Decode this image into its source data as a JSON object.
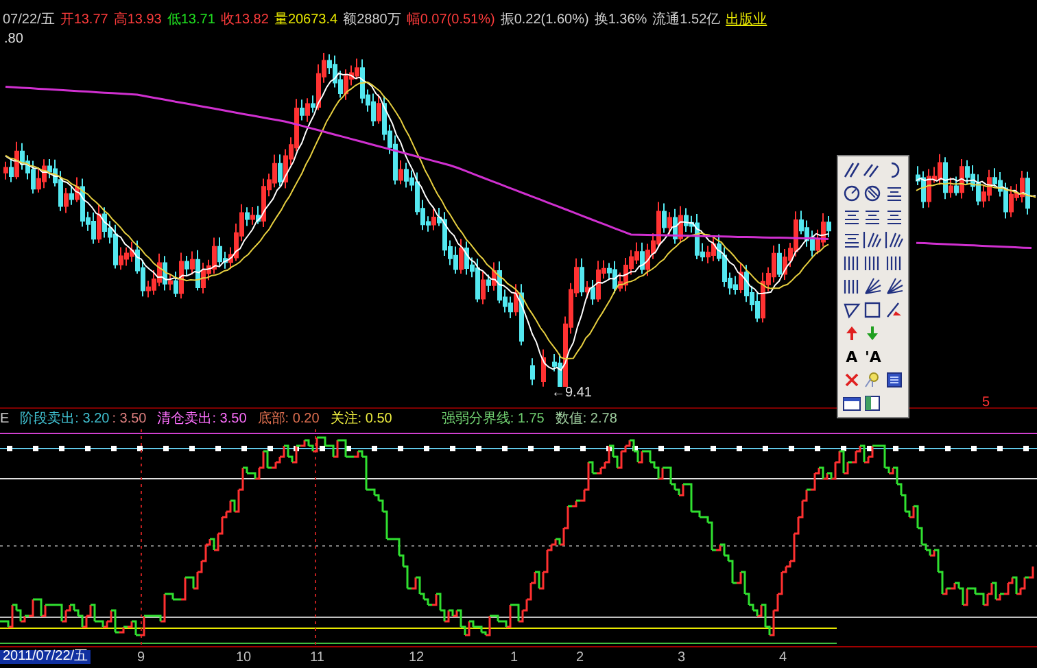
{
  "quote_bar": {
    "date": "07/22/五",
    "fields": [
      {
        "label": "开",
        "value": "13.77",
        "color": "#ff3c3c"
      },
      {
        "label": "高",
        "value": "13.93",
        "color": "#ff3c3c"
      },
      {
        "label": "低",
        "value": "13.71",
        "color": "#20e020"
      },
      {
        "label": "收",
        "value": "13.82",
        "color": "#ff3c3c"
      },
      {
        "label": "量",
        "value": "20673.4",
        "color": "#e8e800"
      },
      {
        "label": "额",
        "value": "2880万",
        "color": "#d0d0d0"
      },
      {
        "label": "幅",
        "value": "0.07(0.51%)",
        "color": "#ff3c3c"
      },
      {
        "label": "振",
        "value": "0.22(1.60%)",
        "color": "#d0d0d0"
      },
      {
        "label": "换",
        "value": "1.36%",
        "color": "#d0d0d0"
      },
      {
        "label": "流通",
        "value": "1.52亿",
        "color": "#d0d0d0"
      }
    ],
    "industry": "出版业"
  },
  "price_chart": {
    "axis_label": ".80",
    "low_marker": "←9.41",
    "marker": "5"
  },
  "toolbox": {
    "tools": [
      {
        "kind": "line"
      },
      {
        "kind": "parallel"
      },
      {
        "kind": "arc"
      },
      {
        "kind": "circle"
      },
      {
        "kind": "hatched-circle"
      },
      {
        "kind": "text-lines"
      },
      {
        "kind": "text-lines"
      },
      {
        "kind": "text-lines"
      },
      {
        "kind": "text-lines"
      },
      {
        "kind": "text-lines"
      },
      {
        "kind": "fan"
      },
      {
        "kind": "fan"
      },
      {
        "kind": "bars"
      },
      {
        "kind": "bars"
      },
      {
        "kind": "bars"
      },
      {
        "kind": "bars"
      },
      {
        "kind": "rays"
      },
      {
        "kind": "rays"
      },
      {
        "kind": "triangle"
      },
      {
        "kind": "rectangle"
      },
      {
        "kind": "pen"
      },
      {
        "kind": "up-arrow"
      },
      {
        "kind": "down-arrow"
      },
      {
        "kind": "letter",
        "label": "A"
      },
      {
        "kind": "letter",
        "label": "'A"
      },
      {
        "kind": "cross"
      },
      {
        "kind": "bulb"
      },
      {
        "kind": "panel"
      },
      {
        "kind": "window"
      },
      {
        "kind": "sidebar-window"
      }
    ]
  },
  "indicator": {
    "cut_label": "E",
    "readings": [
      {
        "text": "阶段卖出: 3.20",
        "color": "#40c0d0"
      },
      {
        "text": ": 3.50",
        "color": "#e08080"
      },
      {
        "text": "清仓卖出: 3.50",
        "color": "#ff70ff"
      },
      {
        "text": "底部: 0.20",
        "color": "#e07050"
      },
      {
        "text": "关注: 0.50",
        "color": "#f0f040"
      },
      {
        "text": "强弱分界线: 1.75",
        "color": "#70d070"
      },
      {
        "text": "数值: 2.78",
        "color": "#a0d0a0"
      }
    ]
  },
  "x_axis": {
    "cursor_date": "2011/07/22/五",
    "ticks": [
      {
        "label": "9"
      },
      {
        "label": "10"
      },
      {
        "label": "11"
      },
      {
        "label": "12"
      },
      {
        "label": "1"
      },
      {
        "label": "2"
      },
      {
        "label": "3"
      },
      {
        "label": "4"
      }
    ]
  }
}
